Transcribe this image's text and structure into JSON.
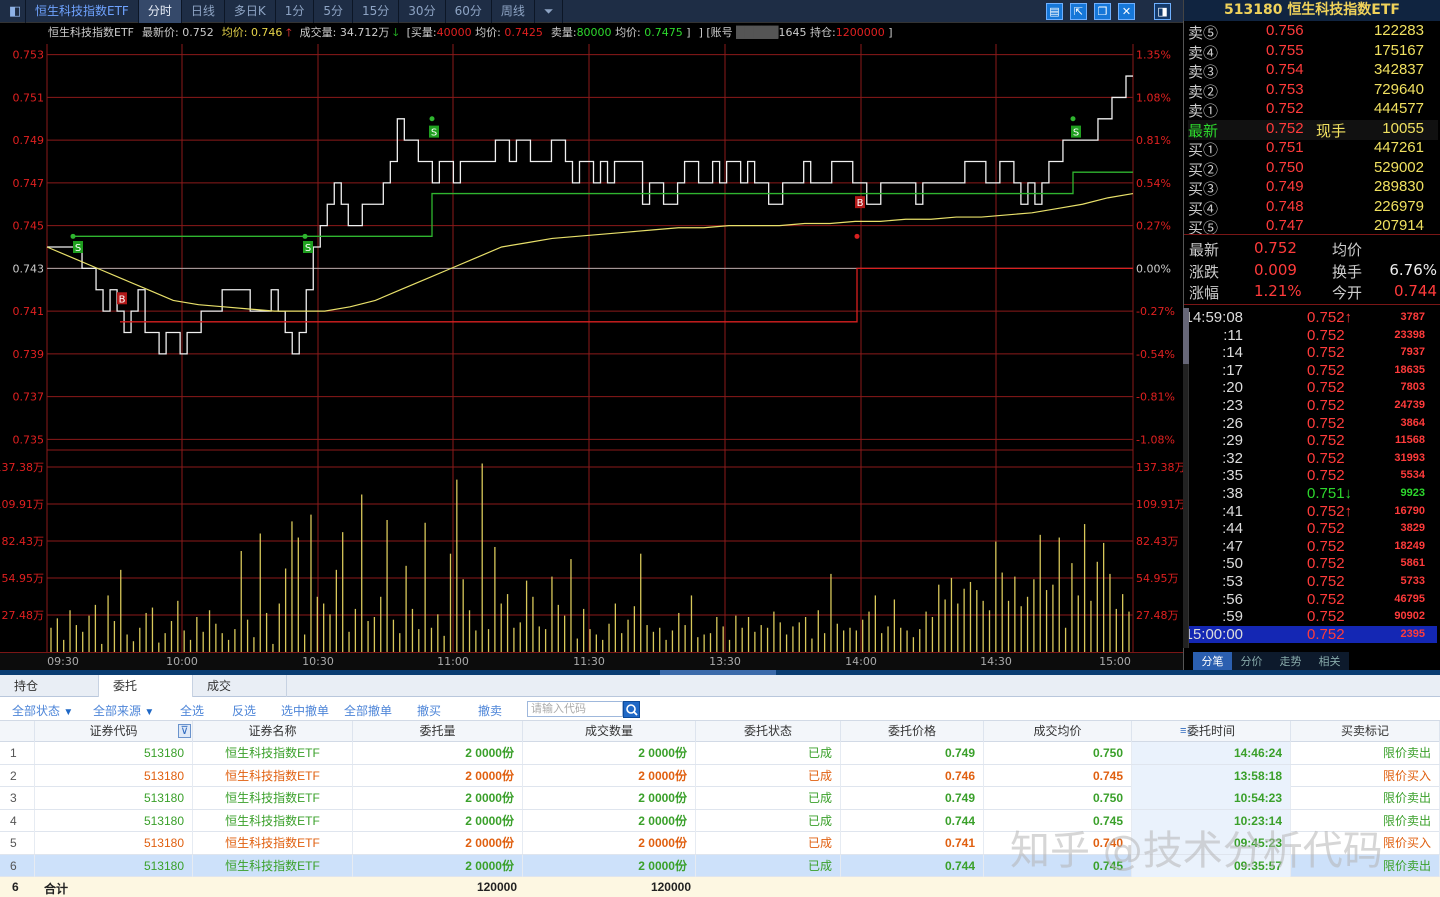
{
  "toolbar": {
    "title": "恒生科技指数ETF",
    "periods": [
      "分时",
      "日线",
      "多日K",
      "1分",
      "5分",
      "15分",
      "30分",
      "60分",
      "周线"
    ],
    "active_period": "分时",
    "icons": [
      "layout-icon",
      "popout-icon",
      "restore-icon",
      "close-icon",
      "panel-icon"
    ]
  },
  "quote_header": {
    "code": "513180",
    "name": "恒生科技指数ETF"
  },
  "info_line": {
    "name": "恒生科技指数ETF",
    "latest_label": "最新价:",
    "latest": "0.752",
    "avg_label": "均价:",
    "avg": "0.746",
    "vol_label": "成交量:",
    "vol": "34.712万",
    "buy_label": "[买量:",
    "buy_qty": "40000",
    "buy_avg_label": "均价:",
    "buy_avg": "0.7425",
    "sell_label": "卖量:",
    "sell_qty": "80000",
    "sell_avg_label": "均价:",
    "sell_avg": "0.7475",
    "acct_label": "] [账号",
    "acct": "1645",
    "pos_label": "持仓:",
    "pos": "1200000",
    "close": "]"
  },
  "chart_data": {
    "type": "line",
    "title": "",
    "prev_close": 0.743,
    "price_ticks": [
      "0.753",
      "0.751",
      "0.749",
      "0.747",
      "0.745",
      "0.743",
      "0.741",
      "0.739",
      "0.737",
      "0.735"
    ],
    "pct_ticks": [
      "1.35%",
      "1.08%",
      "0.81%",
      "0.54%",
      "0.27%",
      "0.00%",
      "-0.27%",
      "-0.54%",
      "-0.81%",
      "-1.08%"
    ],
    "vol_ticks": [
      "137.38万",
      "109.91万",
      "82.43万",
      "54.95万",
      "27.48万"
    ],
    "time_ticks": [
      "09:30",
      "10:00",
      "10:30",
      "11:00",
      "11:30",
      "13:30",
      "14:00",
      "14:30",
      "15:00"
    ],
    "ylim": [
      0.7345,
      0.7535
    ],
    "vol_max": 1500000,
    "series": [
      {
        "values": [
          0.744,
          0.744,
          0.744,
          0.744,
          0.744,
          0.743,
          0.743,
          0.742,
          0.741,
          0.742,
          0.741,
          0.74,
          0.741,
          0.742,
          0.74,
          0.74,
          0.739,
          0.74,
          0.74,
          0.739,
          0.74,
          0.74,
          0.741,
          0.741,
          0.741,
          0.742,
          0.742,
          0.742,
          0.742,
          0.741,
          0.741,
          0.741,
          0.742,
          0.741,
          0.74,
          0.739,
          0.74,
          0.742,
          0.744,
          0.745,
          0.746,
          0.747,
          0.746,
          0.745,
          0.745,
          0.746,
          0.746,
          0.746,
          0.747,
          0.748,
          0.75,
          0.749,
          0.749,
          0.748,
          0.748,
          0.747,
          0.748,
          0.748,
          0.747,
          0.748,
          0.748,
          0.748,
          0.748,
          0.748,
          0.749,
          0.749,
          0.748,
          0.749,
          0.749,
          0.748,
          0.748,
          0.748,
          0.749,
          0.749,
          0.748,
          0.747,
          0.748,
          0.748,
          0.747,
          0.748,
          0.747,
          0.748,
          0.748,
          0.748,
          0.748,
          0.746,
          0.747,
          0.747,
          0.746,
          0.746,
          0.747,
          0.748,
          0.748,
          0.747,
          0.747,
          0.748,
          0.747,
          0.748,
          0.748,
          0.747,
          0.748,
          0.747,
          0.747,
          0.746,
          0.746,
          0.747,
          0.747,
          0.747,
          0.748,
          0.747,
          0.747,
          0.747,
          0.748,
          0.748,
          0.748,
          0.747,
          0.747,
          0.746,
          0.746,
          0.747,
          0.747,
          0.747,
          0.747,
          0.747,
          0.746,
          0.747,
          0.747,
          0.747,
          0.747,
          0.747,
          0.747,
          0.748,
          0.748,
          0.748,
          0.747,
          0.747,
          0.748,
          0.748,
          0.747,
          0.746,
          0.747,
          0.746,
          0.747,
          0.748,
          0.748,
          0.749,
          0.749,
          0.749,
          0.749,
          0.749,
          0.75,
          0.75,
          0.751,
          0.751,
          0.752,
          0.752
        ]
      },
      {
        "values": [
          0.744,
          0.7435,
          0.743,
          0.7425,
          0.742,
          0.7415,
          0.7413,
          0.7412,
          0.7411,
          0.741,
          0.741,
          0.741,
          0.7412,
          0.7415,
          0.742,
          0.7425,
          0.743,
          0.7435,
          0.744,
          0.7442,
          0.7444,
          0.7445,
          0.7446,
          0.7447,
          0.7448,
          0.7449,
          0.7449,
          0.745,
          0.745,
          0.745,
          0.7451,
          0.7451,
          0.7452,
          0.7452,
          0.7453,
          0.7453,
          0.7454,
          0.7454,
          0.7455,
          0.7456,
          0.7458,
          0.746,
          0.7463,
          0.7465
        ]
      }
    ],
    "volume": [
      180000,
      250000,
      90000,
      310000,
      200000,
      150000,
      270000,
      350000,
      60000,
      420000,
      230000,
      610000,
      130000,
      80000,
      180000,
      290000,
      330000,
      70000,
      140000,
      230000,
      380000,
      160000,
      90000,
      260000,
      150000,
      310000,
      210000,
      140000,
      90000,
      170000,
      750000,
      240000,
      110000,
      880000,
      290000,
      60000,
      360000,
      620000,
      970000,
      850000,
      130000,
      1020000,
      410000,
      360000,
      280000,
      610000,
      890000,
      150000,
      320000,
      1170000,
      230000,
      260000,
      410000,
      980000,
      240000,
      140000,
      640000,
      320000,
      170000,
      960000,
      180000,
      280000,
      120000,
      730000,
      1280000,
      540000,
      310000,
      160000,
      1400000,
      170000,
      780000,
      360000,
      430000,
      180000,
      220000,
      530000,
      410000,
      190000,
      170000,
      560000,
      350000,
      270000,
      690000,
      100000,
      320000,
      170000,
      130000,
      90000,
      210000,
      360000,
      140000,
      240000,
      340000,
      730000,
      200000,
      150000,
      180000,
      90000,
      160000,
      290000,
      200000,
      420000,
      110000,
      130000,
      140000,
      260000,
      190000,
      90000,
      270000,
      180000,
      260000,
      150000,
      200000,
      180000,
      300000,
      220000,
      130000,
      190000,
      220000,
      260000,
      100000,
      310000,
      140000,
      580000,
      210000,
      160000,
      180000,
      160000,
      240000,
      300000,
      420000,
      140000,
      190000,
      390000,
      180000,
      160000,
      110000,
      170000,
      300000,
      260000,
      500000,
      390000,
      550000,
      360000,
      470000,
      520000,
      460000,
      380000,
      310000,
      820000,
      590000,
      380000,
      560000,
      340000,
      410000,
      540000,
      870000,
      460000,
      500000,
      850000,
      180000,
      660000,
      420000,
      950000,
      380000,
      670000,
      810000,
      580000,
      320000,
      430000,
      300000
    ]
  },
  "quote": {
    "asks": [
      {
        "label": "卖⑤",
        "price": "0.756",
        "vol": "122283"
      },
      {
        "label": "卖④",
        "price": "0.755",
        "vol": "175167"
      },
      {
        "label": "卖③",
        "price": "0.754",
        "vol": "342837"
      },
      {
        "label": "卖②",
        "price": "0.753",
        "vol": "729640"
      },
      {
        "label": "卖①",
        "price": "0.752",
        "vol": "444577"
      }
    ],
    "last": {
      "label": "最新",
      "price": "0.752",
      "tag": "现手",
      "vol": "10055"
    },
    "bids": [
      {
        "label": "买①",
        "price": "0.751",
        "vol": "447261"
      },
      {
        "label": "买②",
        "price": "0.750",
        "vol": "529002"
      },
      {
        "label": "买③",
        "price": "0.749",
        "vol": "289830"
      },
      {
        "label": "买④",
        "price": "0.748",
        "vol": "226979"
      },
      {
        "label": "买⑤",
        "price": "0.747",
        "vol": "207914"
      }
    ],
    "stats": [
      {
        "l1": "最新",
        "v1": "0.752",
        "l2": "均价",
        "v2": ""
      },
      {
        "l1": "涨跌",
        "v1": "0.009",
        "l2": "换手",
        "v2": "6.76%"
      },
      {
        "l1": "涨幅",
        "v1": "1.21%",
        "l2": "今开",
        "v2": "0.744"
      }
    ]
  },
  "ticks": [
    {
      "t": "14:59:08",
      "p": "0.752↑",
      "v": "3787",
      "dir": "up"
    },
    {
      "t": ":11",
      "p": "0.752",
      "v": "23398",
      "dir": "up"
    },
    {
      "t": ":14",
      "p": "0.752",
      "v": "7937",
      "dir": "up"
    },
    {
      "t": ":17",
      "p": "0.752",
      "v": "18635",
      "dir": "up"
    },
    {
      "t": ":20",
      "p": "0.752",
      "v": "7803",
      "dir": "up"
    },
    {
      "t": ":23",
      "p": "0.752",
      "v": "24739",
      "dir": "up"
    },
    {
      "t": ":26",
      "p": "0.752",
      "v": "3864",
      "dir": "up"
    },
    {
      "t": ":29",
      "p": "0.752",
      "v": "11568",
      "dir": "up"
    },
    {
      "t": ":32",
      "p": "0.752",
      "v": "31993",
      "dir": "up"
    },
    {
      "t": ":35",
      "p": "0.752",
      "v": "5534",
      "dir": "up"
    },
    {
      "t": ":38",
      "p": "0.751↓",
      "v": "9923",
      "dir": "down"
    },
    {
      "t": ":41",
      "p": "0.752↑",
      "v": "16790",
      "dir": "up"
    },
    {
      "t": ":44",
      "p": "0.752",
      "v": "3829",
      "dir": "up"
    },
    {
      "t": ":47",
      "p": "0.752",
      "v": "18249",
      "dir": "up"
    },
    {
      "t": ":50",
      "p": "0.752",
      "v": "5861",
      "dir": "up"
    },
    {
      "t": ":53",
      "p": "0.752",
      "v": "5733",
      "dir": "up"
    },
    {
      "t": ":56",
      "p": "0.752",
      "v": "46795",
      "dir": "up"
    },
    {
      "t": ":59",
      "p": "0.752",
      "v": "90902",
      "dir": "up"
    },
    {
      "t": "15:00:00",
      "p": "0.752",
      "v": "2395",
      "dir": "up"
    }
  ],
  "right_tabs": [
    "分笔",
    "分价",
    "走势",
    "相关"
  ],
  "bottom": {
    "tabs": [
      "持仓",
      "委托",
      "成交"
    ],
    "toolbar": [
      "全部状态",
      "全部来源",
      "全选",
      "反选",
      "选中撤单",
      "全部撤单",
      "撤买",
      "撤卖"
    ],
    "search_placeholder": "请输入代码",
    "columns": [
      "证券代码",
      "证券名称",
      "委托量",
      "成交数量",
      "委托状态",
      "委托价格",
      "成交均价",
      "委托时间",
      "买卖标记"
    ],
    "rows": [
      {
        "no": "1",
        "code": "513180",
        "name": "恒生科技指数ETF",
        "qty": "2 0000份",
        "filled": "2 0000份",
        "status": "已成",
        "price": "0.749",
        "avg": "0.750",
        "time": "14:46:24",
        "side": "限价卖出",
        "type": "sell"
      },
      {
        "no": "2",
        "code": "513180",
        "name": "恒生科技指数ETF",
        "qty": "2 0000份",
        "filled": "2 0000份",
        "status": "已成",
        "price": "0.746",
        "avg": "0.745",
        "time": "13:58:18",
        "side": "限价买入",
        "type": "buy"
      },
      {
        "no": "3",
        "code": "513180",
        "name": "恒生科技指数ETF",
        "qty": "2 0000份",
        "filled": "2 0000份",
        "status": "已成",
        "price": "0.749",
        "avg": "0.750",
        "time": "10:54:23",
        "side": "限价卖出",
        "type": "sell"
      },
      {
        "no": "4",
        "code": "513180",
        "name": "恒生科技指数ETF",
        "qty": "2 0000份",
        "filled": "2 0000份",
        "status": "已成",
        "price": "0.744",
        "avg": "0.745",
        "time": "10:23:14",
        "side": "限价卖出",
        "type": "sell"
      },
      {
        "no": "5",
        "code": "513180",
        "name": "恒生科技指数ETF",
        "qty": "2 0000份",
        "filled": "2 0000份",
        "status": "已成",
        "price": "0.741",
        "avg": "0.740",
        "time": "09:45:23",
        "side": "限价买入",
        "type": "buy"
      },
      {
        "no": "6",
        "code": "513180",
        "name": "恒生科技指数ETF",
        "qty": "2 0000份",
        "filled": "2 0000份",
        "status": "已成",
        "price": "0.744",
        "avg": "0.745",
        "time": "09:35:57",
        "side": "限价卖出",
        "type": "sell"
      }
    ],
    "total_row": {
      "no": "6",
      "label": "合计",
      "qty": "120000",
      "filled": "120000"
    }
  },
  "watermark": "知乎 @技术分析代码"
}
